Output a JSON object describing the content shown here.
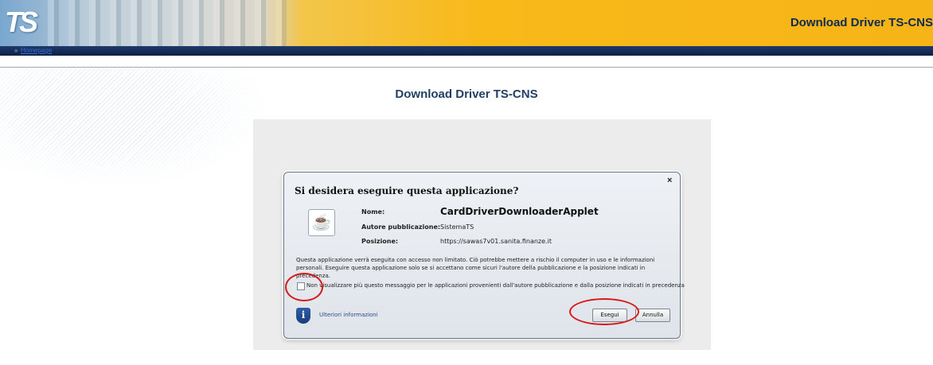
{
  "header": {
    "logo_text": "TS",
    "title": "Download Driver TS-CNS",
    "nav_link": "Homepage",
    "brand_color": "#f7b417",
    "nav_color": "#0c1f44"
  },
  "page": {
    "title": "Download Driver TS-CNS"
  },
  "dialog": {
    "title": "Si desidera eseguire questa applicazione?",
    "close_glyph": "×",
    "name_label": "Nome:",
    "name_value": "CardDriverDownloaderApplet",
    "publisher_label": "Autore pubblicazione:",
    "publisher_value": "SistemaTS",
    "location_label": "Posizione:",
    "location_value": "https://sawas7v01.sanita.finanze.it",
    "warning_text": "Questa applicazione verrà eseguita con accesso non limitato. Ciò potrebbe mettere a rischio il computer in uso e le informazioni personali. Eseguire questa applicazione solo se si accettano come sicuri l'autore della pubblicazione e la posizione indicati in precedenza.",
    "checkbox_label": "Non visualizzare più questo messaggio per le applicazioni provenienti dall'autore pubblicazione e dalla posizione indicati in precedenza",
    "checkbox_checked": false,
    "more_info_link": "Ulteriori informazioni",
    "run_button": "Esegui",
    "cancel_button": "Annulla",
    "highlight_color": "#d81a1a"
  },
  "icons": {
    "java": "java-icon",
    "info": "info-shield-icon",
    "close": "close-icon"
  }
}
